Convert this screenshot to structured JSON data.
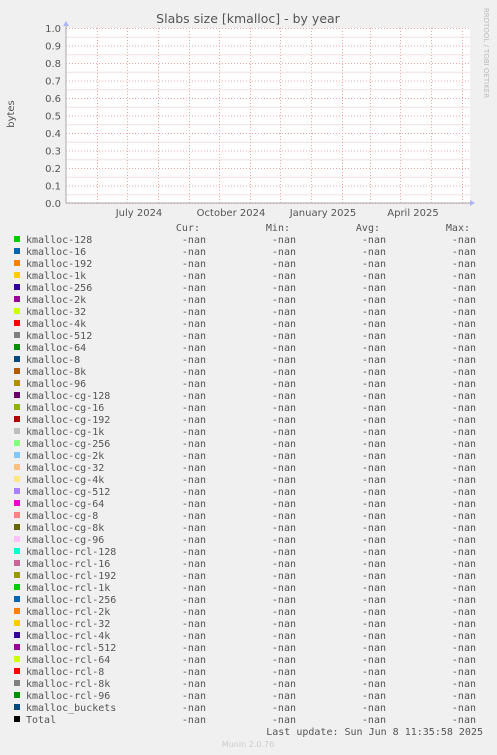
{
  "chart_data": {
    "type": "line",
    "title": "Slabs size [kmalloc] - by year",
    "xlabel": "",
    "ylabel": "bytes",
    "ylim": [
      0,
      1
    ],
    "y_ticks": [
      "0.0",
      "0.1",
      "0.2",
      "0.3",
      "0.4",
      "0.5",
      "0.6",
      "0.7",
      "0.8",
      "0.9",
      "1.0"
    ],
    "x_ticks": [
      "July 2024",
      "October 2024",
      "January 2025",
      "April 2025"
    ],
    "grid": true,
    "series": [
      {
        "name": "kmalloc-128",
        "color": "#00cc00",
        "values": []
      },
      {
        "name": "kmalloc-16",
        "color": "#0066b3",
        "values": []
      },
      {
        "name": "kmalloc-192",
        "color": "#ff8000",
        "values": []
      },
      {
        "name": "kmalloc-1k",
        "color": "#ffcc00",
        "values": []
      },
      {
        "name": "kmalloc-256",
        "color": "#330099",
        "values": []
      },
      {
        "name": "kmalloc-2k",
        "color": "#990099",
        "values": []
      },
      {
        "name": "kmalloc-32",
        "color": "#ccff00",
        "values": []
      },
      {
        "name": "kmalloc-4k",
        "color": "#ff0000",
        "values": []
      },
      {
        "name": "kmalloc-512",
        "color": "#808080",
        "values": []
      },
      {
        "name": "kmalloc-64",
        "color": "#008f00",
        "values": []
      },
      {
        "name": "kmalloc-8",
        "color": "#00487d",
        "values": []
      },
      {
        "name": "kmalloc-8k",
        "color": "#b35a00",
        "values": []
      },
      {
        "name": "kmalloc-96",
        "color": "#b38f00",
        "values": []
      },
      {
        "name": "kmalloc-cg-128",
        "color": "#6b006b",
        "values": []
      },
      {
        "name": "kmalloc-cg-16",
        "color": "#8fb300",
        "values": []
      },
      {
        "name": "kmalloc-cg-192",
        "color": "#b30000",
        "values": []
      },
      {
        "name": "kmalloc-cg-1k",
        "color": "#bebebe",
        "values": []
      },
      {
        "name": "kmalloc-cg-256",
        "color": "#80ff80",
        "values": []
      },
      {
        "name": "kmalloc-cg-2k",
        "color": "#80c9ff",
        "values": []
      },
      {
        "name": "kmalloc-cg-32",
        "color": "#ffc080",
        "values": []
      },
      {
        "name": "kmalloc-cg-4k",
        "color": "#ffe680",
        "values": []
      },
      {
        "name": "kmalloc-cg-512",
        "color": "#aa80ff",
        "values": []
      },
      {
        "name": "kmalloc-cg-64",
        "color": "#ee00cc",
        "values": []
      },
      {
        "name": "kmalloc-cg-8",
        "color": "#ff8080",
        "values": []
      },
      {
        "name": "kmalloc-cg-8k",
        "color": "#666600",
        "values": []
      },
      {
        "name": "kmalloc-cg-96",
        "color": "#ffbfff",
        "values": []
      },
      {
        "name": "kmalloc-rcl-128",
        "color": "#00ffcc",
        "values": []
      },
      {
        "name": "kmalloc-rcl-16",
        "color": "#cc6699",
        "values": []
      },
      {
        "name": "kmalloc-rcl-192",
        "color": "#999900",
        "values": []
      },
      {
        "name": "kmalloc-rcl-1k",
        "color": "#00cc00",
        "values": []
      },
      {
        "name": "kmalloc-rcl-256",
        "color": "#0066b3",
        "values": []
      },
      {
        "name": "kmalloc-rcl-2k",
        "color": "#ff8000",
        "values": []
      },
      {
        "name": "kmalloc-rcl-32",
        "color": "#ffcc00",
        "values": []
      },
      {
        "name": "kmalloc-rcl-4k",
        "color": "#330099",
        "values": []
      },
      {
        "name": "kmalloc-rcl-512",
        "color": "#990099",
        "values": []
      },
      {
        "name": "kmalloc-rcl-64",
        "color": "#ccff00",
        "values": []
      },
      {
        "name": "kmalloc-rcl-8",
        "color": "#ff0000",
        "values": []
      },
      {
        "name": "kmalloc-rcl-8k",
        "color": "#808080",
        "values": []
      },
      {
        "name": "kmalloc-rcl-96",
        "color": "#008f00",
        "values": []
      },
      {
        "name": "kmalloc_buckets",
        "color": "#00487d",
        "values": []
      },
      {
        "name": "Total",
        "color": "#000000",
        "values": []
      }
    ]
  },
  "legend": {
    "headers": {
      "cur": "Cur:",
      "min": "Min:",
      "avg": "Avg:",
      "max": "Max:"
    },
    "rows": [
      {
        "name": "kmalloc-128",
        "cur": "-nan",
        "min": "-nan",
        "avg": "-nan",
        "max": "-nan"
      },
      {
        "name": "kmalloc-16",
        "cur": "-nan",
        "min": "-nan",
        "avg": "-nan",
        "max": "-nan"
      },
      {
        "name": "kmalloc-192",
        "cur": "-nan",
        "min": "-nan",
        "avg": "-nan",
        "max": "-nan"
      },
      {
        "name": "kmalloc-1k",
        "cur": "-nan",
        "min": "-nan",
        "avg": "-nan",
        "max": "-nan"
      },
      {
        "name": "kmalloc-256",
        "cur": "-nan",
        "min": "-nan",
        "avg": "-nan",
        "max": "-nan"
      },
      {
        "name": "kmalloc-2k",
        "cur": "-nan",
        "min": "-nan",
        "avg": "-nan",
        "max": "-nan"
      },
      {
        "name": "kmalloc-32",
        "cur": "-nan",
        "min": "-nan",
        "avg": "-nan",
        "max": "-nan"
      },
      {
        "name": "kmalloc-4k",
        "cur": "-nan",
        "min": "-nan",
        "avg": "-nan",
        "max": "-nan"
      },
      {
        "name": "kmalloc-512",
        "cur": "-nan",
        "min": "-nan",
        "avg": "-nan",
        "max": "-nan"
      },
      {
        "name": "kmalloc-64",
        "cur": "-nan",
        "min": "-nan",
        "avg": "-nan",
        "max": "-nan"
      },
      {
        "name": "kmalloc-8",
        "cur": "-nan",
        "min": "-nan",
        "avg": "-nan",
        "max": "-nan"
      },
      {
        "name": "kmalloc-8k",
        "cur": "-nan",
        "min": "-nan",
        "avg": "-nan",
        "max": "-nan"
      },
      {
        "name": "kmalloc-96",
        "cur": "-nan",
        "min": "-nan",
        "avg": "-nan",
        "max": "-nan"
      },
      {
        "name": "kmalloc-cg-128",
        "cur": "-nan",
        "min": "-nan",
        "avg": "-nan",
        "max": "-nan"
      },
      {
        "name": "kmalloc-cg-16",
        "cur": "-nan",
        "min": "-nan",
        "avg": "-nan",
        "max": "-nan"
      },
      {
        "name": "kmalloc-cg-192",
        "cur": "-nan",
        "min": "-nan",
        "avg": "-nan",
        "max": "-nan"
      },
      {
        "name": "kmalloc-cg-1k",
        "cur": "-nan",
        "min": "-nan",
        "avg": "-nan",
        "max": "-nan"
      },
      {
        "name": "kmalloc-cg-256",
        "cur": "-nan",
        "min": "-nan",
        "avg": "-nan",
        "max": "-nan"
      },
      {
        "name": "kmalloc-cg-2k",
        "cur": "-nan",
        "min": "-nan",
        "avg": "-nan",
        "max": "-nan"
      },
      {
        "name": "kmalloc-cg-32",
        "cur": "-nan",
        "min": "-nan",
        "avg": "-nan",
        "max": "-nan"
      },
      {
        "name": "kmalloc-cg-4k",
        "cur": "-nan",
        "min": "-nan",
        "avg": "-nan",
        "max": "-nan"
      },
      {
        "name": "kmalloc-cg-512",
        "cur": "-nan",
        "min": "-nan",
        "avg": "-nan",
        "max": "-nan"
      },
      {
        "name": "kmalloc-cg-64",
        "cur": "-nan",
        "min": "-nan",
        "avg": "-nan",
        "max": "-nan"
      },
      {
        "name": "kmalloc-cg-8",
        "cur": "-nan",
        "min": "-nan",
        "avg": "-nan",
        "max": "-nan"
      },
      {
        "name": "kmalloc-cg-8k",
        "cur": "-nan",
        "min": "-nan",
        "avg": "-nan",
        "max": "-nan"
      },
      {
        "name": "kmalloc-cg-96",
        "cur": "-nan",
        "min": "-nan",
        "avg": "-nan",
        "max": "-nan"
      },
      {
        "name": "kmalloc-rcl-128",
        "cur": "-nan",
        "min": "-nan",
        "avg": "-nan",
        "max": "-nan"
      },
      {
        "name": "kmalloc-rcl-16",
        "cur": "-nan",
        "min": "-nan",
        "avg": "-nan",
        "max": "-nan"
      },
      {
        "name": "kmalloc-rcl-192",
        "cur": "-nan",
        "min": "-nan",
        "avg": "-nan",
        "max": "-nan"
      },
      {
        "name": "kmalloc-rcl-1k",
        "cur": "-nan",
        "min": "-nan",
        "avg": "-nan",
        "max": "-nan"
      },
      {
        "name": "kmalloc-rcl-256",
        "cur": "-nan",
        "min": "-nan",
        "avg": "-nan",
        "max": "-nan"
      },
      {
        "name": "kmalloc-rcl-2k",
        "cur": "-nan",
        "min": "-nan",
        "avg": "-nan",
        "max": "-nan"
      },
      {
        "name": "kmalloc-rcl-32",
        "cur": "-nan",
        "min": "-nan",
        "avg": "-nan",
        "max": "-nan"
      },
      {
        "name": "kmalloc-rcl-4k",
        "cur": "-nan",
        "min": "-nan",
        "avg": "-nan",
        "max": "-nan"
      },
      {
        "name": "kmalloc-rcl-512",
        "cur": "-nan",
        "min": "-nan",
        "avg": "-nan",
        "max": "-nan"
      },
      {
        "name": "kmalloc-rcl-64",
        "cur": "-nan",
        "min": "-nan",
        "avg": "-nan",
        "max": "-nan"
      },
      {
        "name": "kmalloc-rcl-8",
        "cur": "-nan",
        "min": "-nan",
        "avg": "-nan",
        "max": "-nan"
      },
      {
        "name": "kmalloc-rcl-8k",
        "cur": "-nan",
        "min": "-nan",
        "avg": "-nan",
        "max": "-nan"
      },
      {
        "name": "kmalloc-rcl-96",
        "cur": "-nan",
        "min": "-nan",
        "avg": "-nan",
        "max": "-nan"
      },
      {
        "name": "kmalloc_buckets",
        "cur": "-nan",
        "min": "-nan",
        "avg": "-nan",
        "max": "-nan"
      },
      {
        "name": "Total",
        "cur": "-nan",
        "min": "-nan",
        "avg": "-nan",
        "max": "-nan"
      }
    ]
  },
  "last_update": "Last update: Sun Jun  8 11:35:58 2025",
  "side_label": "RRDTOOL / TOBI OETIKER",
  "footer": "Munin 2.0.76",
  "colors": {
    "background": "#f0f0f0",
    "plot_bg": "#ffffff",
    "grid": "#e8a8a8",
    "axis": "#aaaaaa",
    "arrow": "#aab4ff"
  }
}
